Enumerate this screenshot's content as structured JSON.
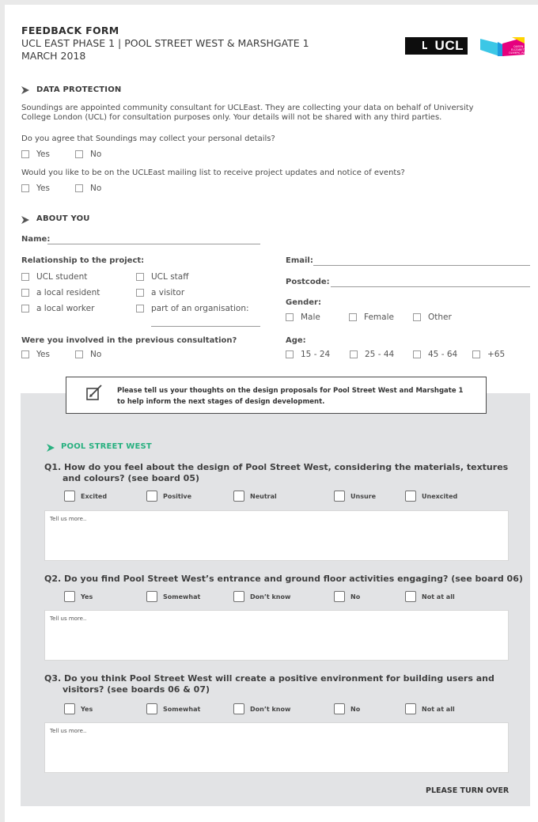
{
  "header": {
    "title": "FEEDBACK FORM",
    "line1": "UCL EAST PHASE 1 | POOL STREET WEST & MARSHGATE 1",
    "line2": "MARCH 2018",
    "logo_ucl": "UCL",
    "logo_qeop": "QUEEN ELIZABETH OLYMPIC PARK"
  },
  "data_protection": {
    "heading": "DATA PROTECTION",
    "text1": "Soundings are appointed community consultant for UCLEast. They are collecting your data on behalf of University",
    "text2": "College London (UCL) for consultation purposes only. Your details will not be shared with any third parties.",
    "q1": "Do you agree that Soundings may collect your personal details?",
    "q2": "Would you like to be on the UCLEast mailing list to receive project updates and notice of events?",
    "yes": "Yes",
    "no": "No"
  },
  "about": {
    "heading": "ABOUT YOU",
    "name": "Name:",
    "relationship": "Relationship to the project:",
    "rel_options": [
      "UCL student",
      "UCL staff",
      "a local resident",
      "a visitor",
      "a local worker",
      "part of an organisation:"
    ],
    "email": "Email:",
    "postcode": "Postcode:",
    "gender": "Gender:",
    "gender_options": [
      "Male",
      "Female",
      "Other"
    ],
    "previous": "Were you involved in the previous consultation?",
    "yes": "Yes",
    "no": "No",
    "age": "Age:",
    "age_options": [
      "15 - 24",
      "25 - 44",
      "45 - 64",
      "+65"
    ]
  },
  "note": {
    "line1": "Please tell us your thoughts on the design proposals for Pool Street West and Marshgate 1",
    "line2": "to help inform the next stages of design development."
  },
  "pool": {
    "heading": "POOL STREET WEST",
    "q1_l1": "Q1. How do you feel about the design of Pool Street West, considering the materials, textures",
    "q1_l2": "and colours? (see board 05)",
    "q1_options": [
      "Excited",
      "Positive",
      "Neutral",
      "Unsure",
      "Unexcited"
    ],
    "q2": "Q2. Do you find Pool Street West’s entrance and ground floor activities engaging? (see board 06)",
    "q3_l1": "Q3. Do you think Pool Street West will create a positive environment for building users and",
    "q3_l2": "visitors? (see boards 06 & 07)",
    "options": [
      "Yes",
      "Somewhat",
      "Don’t know",
      "No",
      "Not at all"
    ],
    "tell_more": "Tell us more..",
    "turn_over": "PLEASE TURN OVER"
  },
  "colors": {
    "accent": "#27b07f",
    "panel": "#e2e3e5"
  }
}
